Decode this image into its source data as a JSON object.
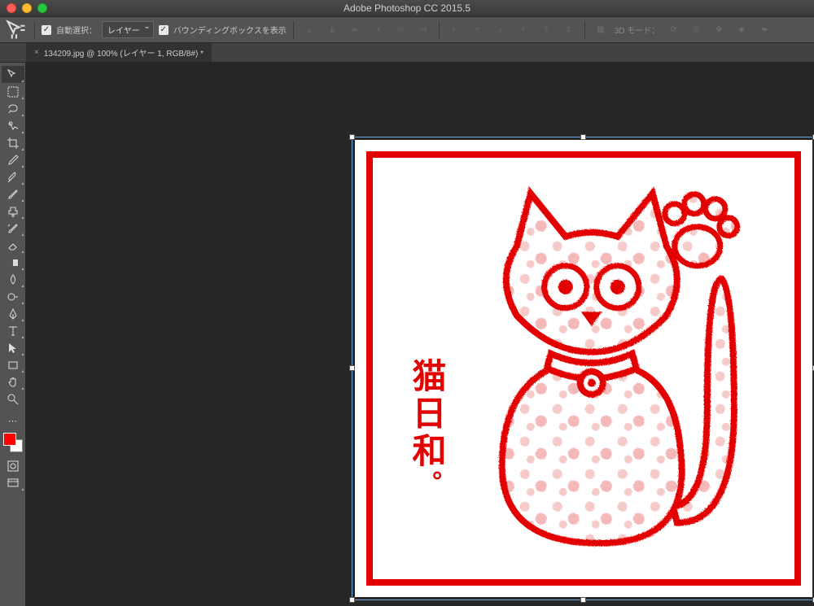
{
  "app": {
    "title": "Adobe Photoshop CC 2015.5"
  },
  "options": {
    "auto_select_label": "自動選択：",
    "auto_select_value": "レイヤー",
    "show_bbox_label": "バウンディングボックスを表示",
    "mode3d_label": "3D モード："
  },
  "tab": {
    "filename": "134209.jpg",
    "zoom": "100%",
    "layer": "レイヤー 1",
    "mode": "RGB/8#",
    "dirty": "*"
  },
  "tools": [
    "move",
    "marquee",
    "lasso",
    "quick-select",
    "crop",
    "eyedropper",
    "healing",
    "brush",
    "clone",
    "history-brush",
    "eraser",
    "gradient",
    "blur",
    "dodge",
    "pen",
    "type",
    "path-select",
    "rectangle",
    "hand",
    "zoom"
  ],
  "swatches": {
    "foreground": "#ff0000",
    "background": "#ffffff"
  },
  "artwork": {
    "vertical_text": "猫日和",
    "text_dot": "。"
  }
}
